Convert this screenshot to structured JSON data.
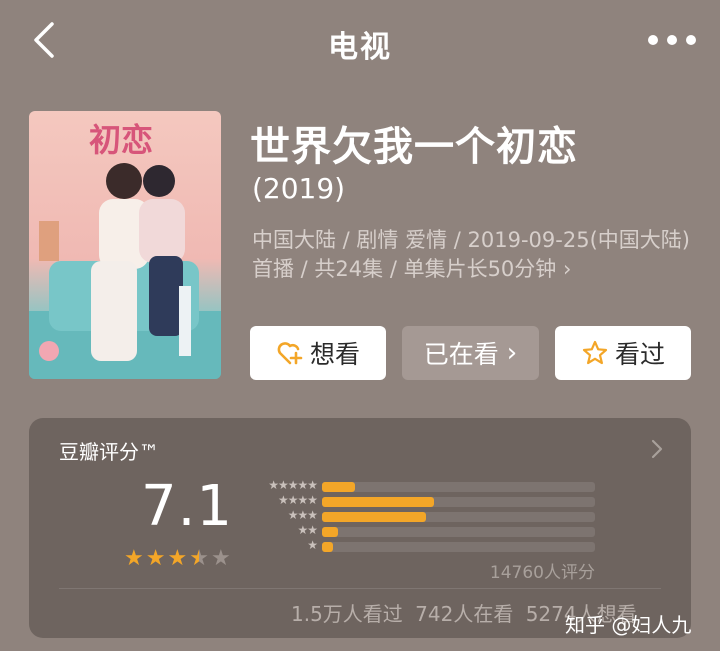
{
  "nav": {
    "title": "电视"
  },
  "show": {
    "title": "世界欠我一个初恋",
    "year": "(2019)",
    "info": "中国大陆 / 剧情 爱情 / 2019-09-25(中国大陆)首播 / 共24集 / 单集片长50分钟",
    "info_arrow": "›",
    "poster_title": "初恋"
  },
  "actions": {
    "want_label": "想看",
    "watching_label": "已在看",
    "watching_arrow": "›",
    "watched_label": "看过"
  },
  "rating": {
    "title": "豆瓣评分™",
    "score": "7.1",
    "stars_filled": 3.5,
    "count_text": "14760人评分",
    "distribution": [
      {
        "stars": 5,
        "label": "★★★★★",
        "fraction": 0.12
      },
      {
        "stars": 4,
        "label": "★★★★",
        "fraction": 0.41
      },
      {
        "stars": 3,
        "label": "★★★",
        "fraction": 0.38
      },
      {
        "stars": 2,
        "label": "★★",
        "fraction": 0.06
      },
      {
        "stars": 1,
        "label": "★",
        "fraction": 0.04
      }
    ],
    "stats": "1.5万人看过  742人在看  5274人想看"
  },
  "watermark": "知乎 @妇人九",
  "colors": {
    "accent": "#f3a628",
    "star_empty": "#9b918c"
  }
}
